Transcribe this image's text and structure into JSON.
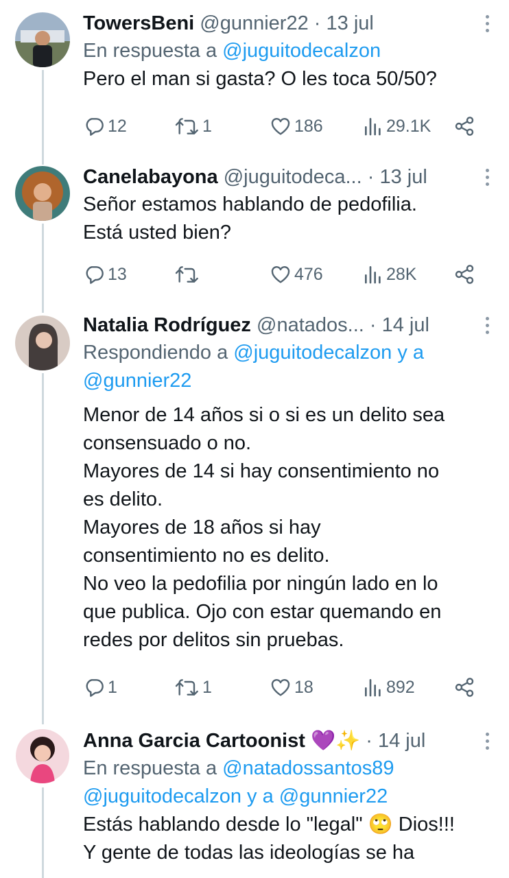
{
  "tweets": [
    {
      "name": "TowersBeni",
      "handle": "@gunnier22",
      "sep": " · ",
      "date": "13 jul",
      "reply_prefix": "En respuesta a ",
      "reply_mentions": "@juguitodecalzon",
      "text": "Pero el man si gasta? O les toca 50/50?",
      "replies": "12",
      "retweets": "1",
      "likes": "186",
      "views": "29.1K"
    },
    {
      "name": "Canelabayona",
      "handle": "@juguitodeca...",
      "sep": " · ",
      "date": "13 jul",
      "text": "Señor estamos hablando de pedofilia.\nEstá usted bien?",
      "replies": "13",
      "retweets": "",
      "likes": "476",
      "views": "28K"
    },
    {
      "name": "Natalia Rodríguez",
      "handle": "@natados...",
      "sep": " · ",
      "date": "14 jul",
      "reply_prefix": "Respondiendo a ",
      "reply_mentions": "@juguitodecalzon y a",
      "reply_mentions_2": "@gunnier22",
      "text": "Menor de 14 años si o si es un delito sea\nconsensuado o no.\nMayores de 14 si hay consentimiento no\nes delito.\nMayores de 18 años si hay\nconsentimiento no es delito.\nNo veo la pedofilia por ningún lado en lo\nque publica. Ojo con estar quemando en\nredes por delitos sin pruebas.",
      "replies": "1",
      "retweets": "1",
      "likes": "18",
      "views": "892"
    },
    {
      "name": "Anna Garcia Cartoonist",
      "name_emoji": "💜✨",
      "sep": " · ",
      "date": "14 jul",
      "reply_prefix": "En respuesta a ",
      "reply_mentions": "@natadossantos89",
      "reply_mentions_2": "@juguitodecalzon y a @gunnier22",
      "text": "Estás hablando desde lo \"legal\" 🙄 Dios!!!\nY gente de todas las ideologías se ha"
    }
  ],
  "icons": {
    "reply": "reply-icon",
    "retweet": "retweet-icon",
    "like": "heart-icon",
    "views": "views-icon",
    "share": "share-icon",
    "more": "more-icon"
  },
  "colors": {
    "text": "#0f1419",
    "secondary": "#536471",
    "mention": "#1d9bf0",
    "thread_line": "#cfd9de"
  }
}
